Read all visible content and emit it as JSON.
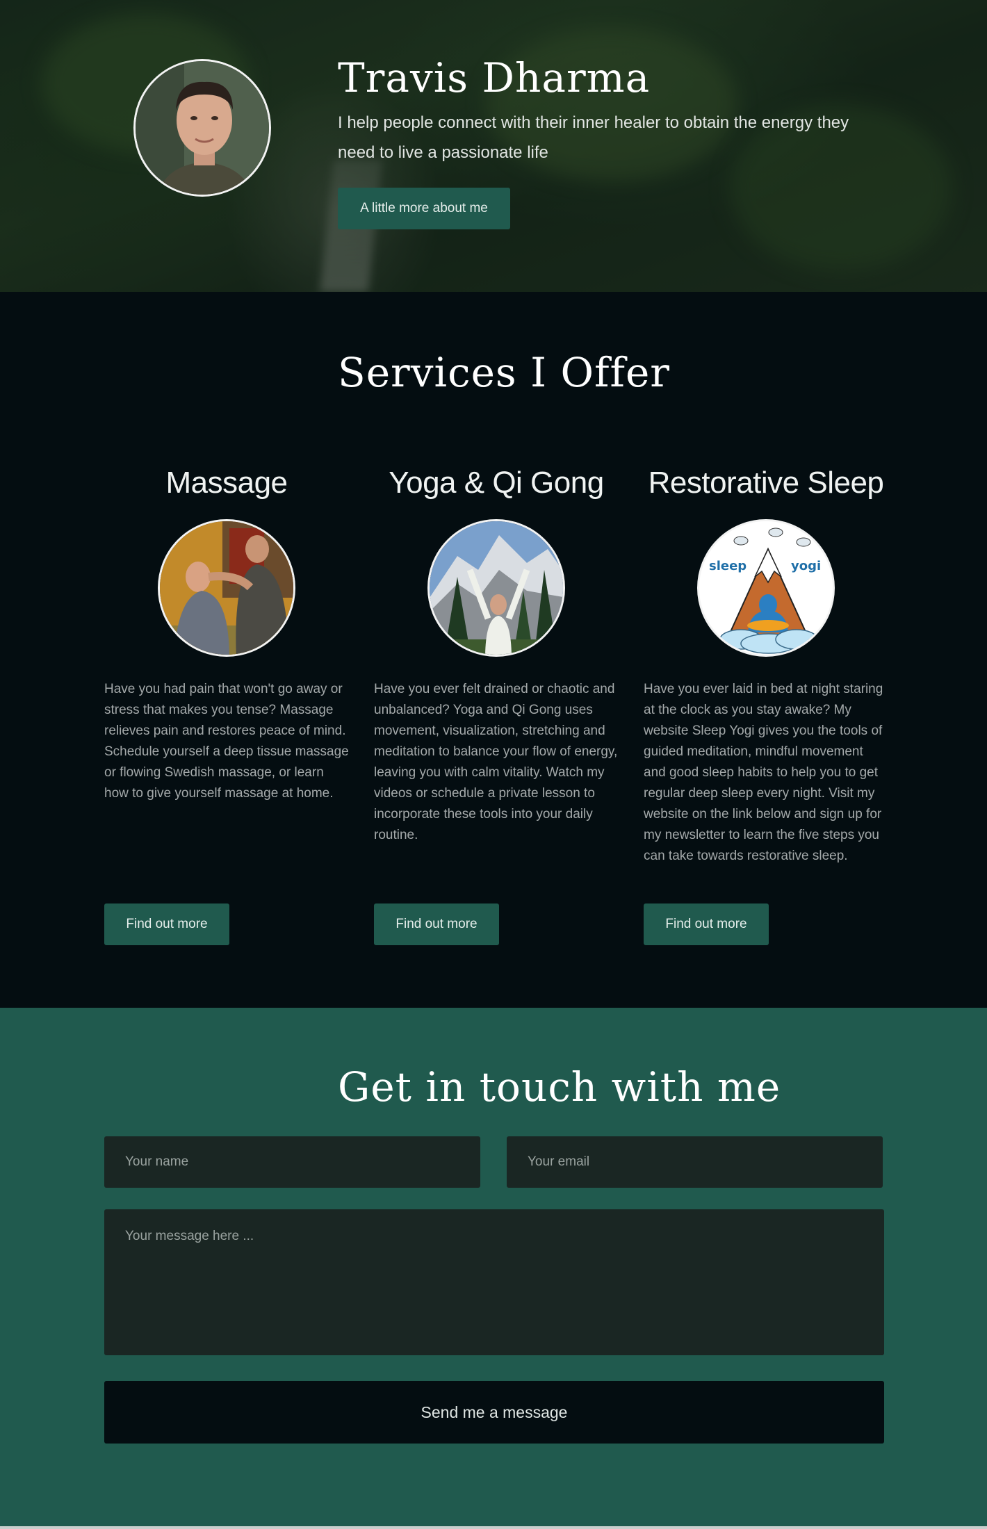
{
  "hero": {
    "title": "Travis Dharma",
    "text": "I help people connect with their inner healer to obtain the energy they need to live a passionate life",
    "button_label": "A little more about me"
  },
  "services": {
    "title": "Services I Offer",
    "items": [
      {
        "title": "Massage",
        "text": "Have you had pain that won't go away or stress that makes you tense? Massage relieves pain and restores peace of mind. Schedule yourself a deep tissue massage or flowing Swedish massage, or learn how to give yourself massage at home.",
        "button_label": "Find out more"
      },
      {
        "title": "Yoga & Qi Gong",
        "text": "Have you ever felt drained or chaotic and unbalanced? Yoga and Qi Gong uses movement, visualization, stretching and meditation to balance your flow of energy, leaving you with calm vitality. Watch my videos or schedule a private lesson to incorporate these tools into your daily routine.",
        "button_label": "Find out more"
      },
      {
        "title": "Restorative Sleep",
        "text": "Have you ever laid in bed at night staring at the clock as you stay awake? My website Sleep Yogi gives you the tools of guided meditation, mindful movement and good sleep habits to help you to get regular deep sleep every night. Visit my website on the link below and sign up for my newsletter to learn the five steps you can take towards restorative sleep.",
        "button_label": "Find out more",
        "logo_words": [
          "sleep",
          "yogi"
        ]
      }
    ]
  },
  "contact": {
    "title": "Get in touch with me",
    "name_placeholder": "Your name",
    "email_placeholder": "Your email",
    "message_placeholder": "Your message here ...",
    "send_label": "Send me a message"
  },
  "colors": {
    "accent": "#205a4e",
    "dark": "#040d11",
    "field": "#1a2623"
  }
}
